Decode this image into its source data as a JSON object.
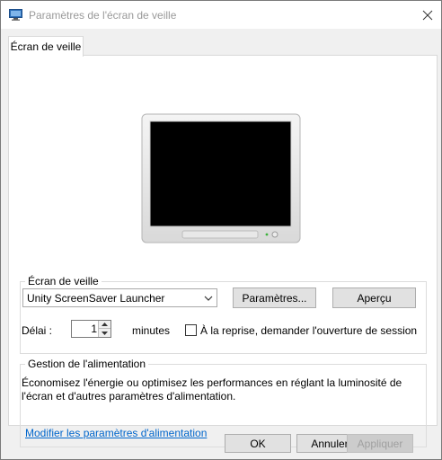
{
  "window": {
    "title": "Paramètres de l'écran de veille"
  },
  "tabs": [
    {
      "label": "Écran de veille"
    }
  ],
  "screensaver_group": {
    "legend": "Écran de veille",
    "selected": "Unity ScreenSaver Launcher",
    "settings_button": "Paramètres...",
    "preview_button": "Aperçu",
    "delay_label": "Délai :",
    "delay_value": "1",
    "minutes_label": "minutes",
    "resume_checkbox_label": "À la reprise, demander l'ouverture de session",
    "resume_checked": false
  },
  "power_group": {
    "legend": "Gestion de l'alimentation",
    "description": "Économisez l'énergie ou optimisez les performances en réglant la luminosité de l'écran et d'autres paramètres d'alimentation.",
    "link": "Modifier les paramètres d'alimentation"
  },
  "footer": {
    "ok": "OK",
    "cancel": "Annuler",
    "apply": "Appliquer"
  },
  "colors": {
    "link": "#0066cc",
    "button_bg": "#e1e1e1",
    "panel_bg": "#f0f0f0"
  }
}
